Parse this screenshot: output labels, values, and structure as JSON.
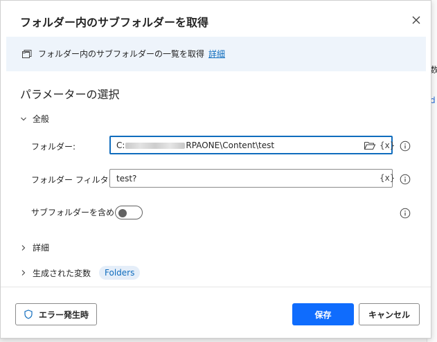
{
  "background": {
    "text1": "数",
    "text2": "d"
  },
  "dialog": {
    "title": "フォルダー内のサブフォルダーを取得",
    "close_icon": "close-icon",
    "info": {
      "icon": "folders-icon",
      "text": "フォルダー内のサブフォルダーの一覧を取得",
      "link": "詳細"
    },
    "section_title": "パラメーターの選択",
    "general": {
      "label": "全般",
      "folder": {
        "label": "フォルダー:",
        "value_prefix": "C:",
        "value_suffix": "RPAONE\\Content\\test",
        "var_label": "{x}"
      },
      "filter": {
        "label": "フォルダー フィルター:",
        "value": "test?",
        "var_label": "{x}"
      },
      "include_subfolders": {
        "label": "サブフォルダーを含める:",
        "state": "off"
      }
    },
    "advanced": {
      "label": "詳細"
    },
    "variables": {
      "label": "生成された変数",
      "pill": "Folders"
    },
    "footer": {
      "on_error": "エラー発生時",
      "save": "保存",
      "cancel": "キャンセル"
    },
    "colors": {
      "accent": "#0f6cbd",
      "save_button": "#0f6cfd",
      "info_bg": "#eef4fb"
    }
  }
}
